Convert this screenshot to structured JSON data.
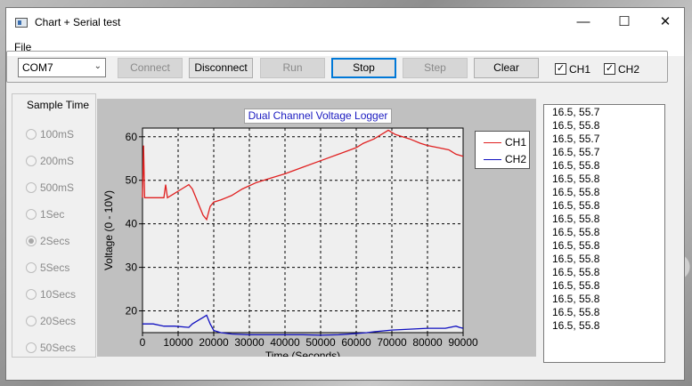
{
  "window": {
    "title": "Chart + Serial test",
    "minimize": "—",
    "maximize": "☐",
    "close": "✕"
  },
  "menu": {
    "file": "File"
  },
  "toolbar": {
    "port": "COM7",
    "connect": "Connect",
    "disconnect": "Disconnect",
    "run": "Run",
    "stop": "Stop",
    "step": "Step",
    "clear": "Clear",
    "ch1": "CH1",
    "ch2": "CH2",
    "check_mark": "✓"
  },
  "sample_time": {
    "title": "Sample Time",
    "options": [
      "100mS",
      "200mS",
      "500mS",
      "1Sec",
      "2Secs",
      "5Secs",
      "10Secs",
      "20Secs",
      "50Secs"
    ],
    "selected": "2Secs"
  },
  "chart_data": {
    "type": "line",
    "title": "Dual Channel Voltage Logger",
    "xlabel": "Time (Seconds)",
    "ylabel": "Voltage (0 - 10V)",
    "xlim": [
      0,
      90000
    ],
    "ylim": [
      15,
      62
    ],
    "xticks": [
      0,
      10000,
      20000,
      30000,
      40000,
      50000,
      60000,
      70000,
      80000,
      90000
    ],
    "yticks": [
      20,
      30,
      40,
      50,
      60
    ],
    "grid": true,
    "legend_position": "right",
    "series": [
      {
        "name": "CH1",
        "color": "#e02020",
        "x": [
          0,
          300,
          600,
          1000,
          3000,
          5000,
          6000,
          6500,
          7000,
          9000,
          11000,
          13000,
          14000,
          15000,
          16000,
          17000,
          18000,
          19000,
          20000,
          22000,
          25000,
          28000,
          32000,
          36000,
          40000,
          45000,
          50000,
          55000,
          60000,
          62000,
          65000,
          67000,
          68000,
          69000,
          70000,
          71000,
          73000,
          75000,
          78000,
          80000,
          83000,
          86000,
          88000,
          90000
        ],
        "y": [
          46,
          58,
          46,
          46,
          46,
          46,
          46,
          49,
          46,
          47,
          48,
          49,
          48,
          46,
          44,
          42,
          41,
          44,
          45,
          45.5,
          46.5,
          48,
          49.5,
          50.5,
          51.5,
          53,
          54.5,
          56,
          57.5,
          58.5,
          59.5,
          60.5,
          61,
          61.5,
          61,
          60.5,
          60,
          59.5,
          58.5,
          58,
          57.5,
          57,
          56,
          55.5
        ]
      },
      {
        "name": "CH2",
        "color": "#1010c0",
        "x": [
          0,
          3000,
          6000,
          9000,
          13000,
          14000,
          16000,
          17000,
          18000,
          19000,
          20000,
          22000,
          25000,
          30000,
          35000,
          40000,
          45000,
          50000,
          55000,
          60000,
          63000,
          65000,
          70000,
          75000,
          80000,
          85000,
          88000,
          89000,
          90000
        ],
        "y": [
          17,
          17,
          16.5,
          16.5,
          16.2,
          17,
          18,
          18.5,
          19,
          17,
          15.5,
          15,
          14.7,
          14.5,
          14.5,
          14.5,
          14.5,
          14.4,
          14.5,
          14.8,
          15,
          15.2,
          15.6,
          15.8,
          16,
          16,
          16.5,
          16.2,
          16
        ]
      }
    ]
  },
  "serial_log": [
    "16.5, 55.7",
    "16.5, 55.8",
    "16.5, 55.7",
    "16.5, 55.7",
    "16.5, 55.8",
    "16.5, 55.8",
    "16.5, 55.8",
    "16.5, 55.8",
    "16.5, 55.8",
    "16.5, 55.8",
    "16.5, 55.8",
    "16.5, 55.8",
    "16.5, 55.8",
    "16.5, 55.8",
    "16.5, 55.8",
    "16.5, 55.8",
    "16.5, 55.8"
  ]
}
